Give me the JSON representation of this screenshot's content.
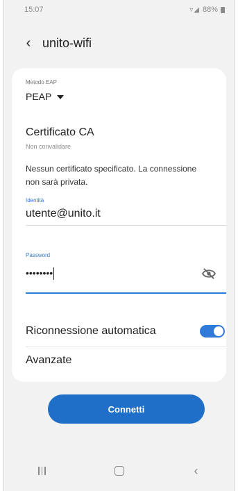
{
  "status_bar": {
    "time": "15:07",
    "battery": "88%"
  },
  "header": {
    "title": "unito-wifi"
  },
  "form": {
    "eap_method_label": "Metodo EAP",
    "eap_method_value": "PEAP",
    "ca_cert_title": "Certificato CA",
    "ca_cert_value": "Non convalidare",
    "ca_cert_warning": "Nessun certificato specificato. La connessione non sarà privata.",
    "identity_label": "Identità",
    "identity_value": "utente@unito.it",
    "password_label": "Password",
    "password_value": "••••••••",
    "auto_reconnect_label": "Riconnessione automatica",
    "auto_reconnect_enabled": true,
    "advanced_label": "Avanzate"
  },
  "actions": {
    "connect_label": "Connetti"
  },
  "colors": {
    "accent": "#2f7ad8",
    "button": "#1f6fc8",
    "background": "#f2f2f2"
  },
  "icons": {
    "back": "chevron-left-icon",
    "dropdown": "caret-down-icon",
    "password_visibility": "eye-off-icon",
    "nav_recents": "recents-icon",
    "nav_home": "home-icon",
    "nav_back": "back-icon"
  }
}
